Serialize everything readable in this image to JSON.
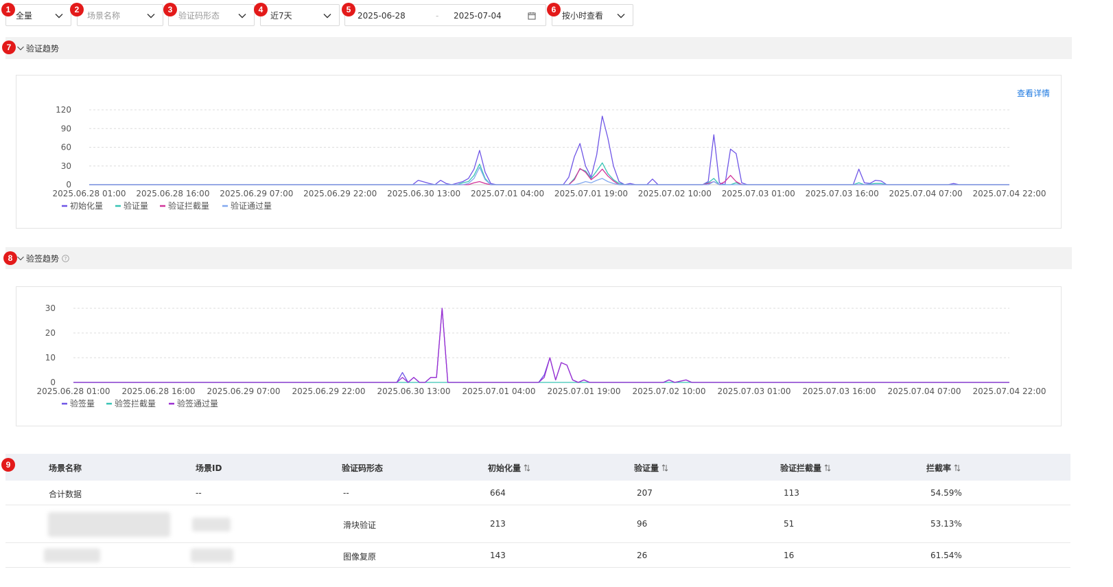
{
  "filters": {
    "scope": "全量",
    "scene_placeholder": "场景名称",
    "captcha_placeholder": "验证码形态",
    "period": "近7天",
    "date_start": "2025-06-28",
    "date_sep": "-",
    "date_end": "2025-07-04",
    "granularity": "按小时查看"
  },
  "badges": [
    "1",
    "2",
    "3",
    "4",
    "5",
    "6",
    "7",
    "8",
    "9"
  ],
  "section_verify": {
    "title": "验证趋势",
    "detail_link": "查看详情"
  },
  "section_sign": {
    "title": "验签趋势"
  },
  "colors": {
    "purple_dark": "#6e55e6",
    "teal": "#37c3b4",
    "magenta": "#d1339a",
    "blue_light": "#82a8ef",
    "violet": "#9b2fd1",
    "badge": "#e31a1a",
    "link": "#1f7ae0"
  },
  "chart_data": [
    {
      "type": "line",
      "title": "",
      "x_ticks": [
        "2025.06.28 01:00",
        "2025.06.28 16:00",
        "2025.06.29 07:00",
        "2025.06.29 22:00",
        "2025.06.30 13:00",
        "2025.07.01 04:00",
        "2025.07.01 19:00",
        "2025.07.02 10:00",
        "2025.07.03 01:00",
        "2025.07.03 16:00",
        "2025.07.04 07:00",
        "2025.07.04 22:00"
      ],
      "ylim": [
        0,
        120
      ],
      "y_ticks": [
        0,
        30,
        60,
        90,
        120
      ],
      "grid": true,
      "legend_position": "bottom-left",
      "hour_range": [
        0,
        165
      ],
      "series": [
        {
          "name": "初始化量",
          "color": "#6e55e6",
          "points": [
            [
              0,
              0
            ],
            [
              58,
              0
            ],
            [
              59,
              7
            ],
            [
              61,
              2
            ],
            [
              62,
              0
            ],
            [
              63,
              7
            ],
            [
              64,
              2
            ],
            [
              65,
              0
            ],
            [
              67,
              5
            ],
            [
              68,
              10
            ],
            [
              69,
              25
            ],
            [
              70,
              55
            ],
            [
              71,
              20
            ],
            [
              72,
              2
            ],
            [
              73,
              0
            ],
            [
              85,
              0
            ],
            [
              86,
              12
            ],
            [
              87,
              45
            ],
            [
              88,
              66
            ],
            [
              89,
              30
            ],
            [
              90,
              12
            ],
            [
              91,
              48
            ],
            [
              92,
              110
            ],
            [
              93,
              75
            ],
            [
              94,
              30
            ],
            [
              95,
              5
            ],
            [
              96,
              0
            ],
            [
              97,
              2
            ],
            [
              98,
              0
            ],
            [
              100,
              0
            ],
            [
              101,
              9
            ],
            [
              102,
              0
            ],
            [
              110,
              0
            ],
            [
              111,
              5
            ],
            [
              112,
              80
            ],
            [
              113,
              3
            ],
            [
              114,
              0
            ],
            [
              115,
              57
            ],
            [
              116,
              50
            ],
            [
              117,
              3
            ],
            [
              118,
              0
            ],
            [
              137,
              0
            ],
            [
              138,
              25
            ],
            [
              139,
              3
            ],
            [
              140,
              2
            ],
            [
              141,
              7
            ],
            [
              142,
              6
            ],
            [
              143,
              0
            ],
            [
              154,
              0
            ],
            [
              155,
              2
            ],
            [
              156,
              0
            ],
            [
              165,
              0
            ]
          ]
        },
        {
          "name": "验证量",
          "color": "#37c3b4",
          "points": [
            [
              0,
              0
            ],
            [
              66,
              0
            ],
            [
              67,
              3
            ],
            [
              68,
              5
            ],
            [
              69,
              15
            ],
            [
              70,
              33
            ],
            [
              71,
              10
            ],
            [
              72,
              0
            ],
            [
              86,
              0
            ],
            [
              87,
              10
            ],
            [
              88,
              25
            ],
            [
              89,
              22
            ],
            [
              90,
              10
            ],
            [
              91,
              22
            ],
            [
              92,
              35
            ],
            [
              93,
              18
            ],
            [
              94,
              8
            ],
            [
              95,
              2
            ],
            [
              96,
              0
            ],
            [
              110,
              0
            ],
            [
              111,
              3
            ],
            [
              112,
              10
            ],
            [
              113,
              0
            ],
            [
              115,
              0
            ],
            [
              116,
              3
            ],
            [
              117,
              0
            ],
            [
              137,
              0
            ],
            [
              138,
              3
            ],
            [
              139,
              0
            ],
            [
              141,
              2
            ],
            [
              142,
              2
            ],
            [
              143,
              0
            ],
            [
              165,
              0
            ]
          ]
        },
        {
          "name": "验证拦截量",
          "color": "#d1339a",
          "points": [
            [
              0,
              0
            ],
            [
              68,
              0
            ],
            [
              69,
              3
            ],
            [
              70,
              5
            ],
            [
              71,
              2
            ],
            [
              72,
              0
            ],
            [
              86,
              0
            ],
            [
              87,
              8
            ],
            [
              88,
              26
            ],
            [
              89,
              20
            ],
            [
              90,
              8
            ],
            [
              91,
              15
            ],
            [
              92,
              25
            ],
            [
              93,
              14
            ],
            [
              94,
              6
            ],
            [
              95,
              0
            ],
            [
              110,
              0
            ],
            [
              111,
              2
            ],
            [
              112,
              5
            ],
            [
              113,
              0
            ],
            [
              114,
              5
            ],
            [
              115,
              15
            ],
            [
              116,
              5
            ],
            [
              117,
              0
            ],
            [
              165,
              0
            ]
          ]
        },
        {
          "name": "验证通过量",
          "color": "#82a8ef",
          "points": [
            [
              0,
              0
            ],
            [
              67,
              0
            ],
            [
              68,
              2
            ],
            [
              69,
              10
            ],
            [
              70,
              28
            ],
            [
              71,
              8
            ],
            [
              72,
              0
            ],
            [
              87,
              0
            ],
            [
              88,
              2
            ],
            [
              89,
              5
            ],
            [
              90,
              3
            ],
            [
              91,
              7
            ],
            [
              92,
              10
            ],
            [
              93,
              5
            ],
            [
              94,
              2
            ],
            [
              95,
              0
            ],
            [
              111,
              0
            ],
            [
              112,
              5
            ],
            [
              113,
              0
            ],
            [
              165,
              0
            ]
          ]
        }
      ]
    },
    {
      "type": "line",
      "title": "",
      "x_ticks": [
        "2025.06.28 01:00",
        "2025.06.28 16:00",
        "2025.06.29 07:00",
        "2025.06.29 22:00",
        "2025.06.30 13:00",
        "2025.07.01 04:00",
        "2025.07.01 19:00",
        "2025.07.02 10:00",
        "2025.07.03 01:00",
        "2025.07.03 16:00",
        "2025.07.04 07:00",
        "2025.07.04 22:00"
      ],
      "ylim": [
        0,
        30
      ],
      "y_ticks": [
        0,
        10,
        20,
        30
      ],
      "grid": true,
      "legend_position": "bottom-left",
      "hour_range": [
        0,
        165
      ],
      "series": [
        {
          "name": "验签量",
          "color": "#6e55e6",
          "points": [
            [
              0,
              0
            ],
            [
              57,
              0
            ],
            [
              58,
              4
            ],
            [
              59,
              0
            ],
            [
              60,
              2
            ],
            [
              61,
              0
            ],
            [
              62,
              0
            ],
            [
              63,
              2
            ],
            [
              64,
              2
            ],
            [
              65,
              30
            ],
            [
              66,
              0
            ],
            [
              82,
              0
            ],
            [
              83,
              3
            ],
            [
              84,
              10
            ],
            [
              85,
              1
            ],
            [
              86,
              8
            ],
            [
              87,
              7
            ],
            [
              88,
              1
            ],
            [
              89,
              0
            ],
            [
              90,
              1
            ],
            [
              91,
              0
            ],
            [
              104,
              0
            ],
            [
              105,
              1
            ],
            [
              106,
              0
            ],
            [
              108,
              1
            ],
            [
              109,
              0
            ],
            [
              165,
              0
            ]
          ]
        },
        {
          "name": "验签拦截量",
          "color": "#37c3b4",
          "points": [
            [
              0,
              0
            ],
            [
              165,
              0
            ]
          ]
        },
        {
          "name": "验签通过量",
          "color": "#9b2fd1",
          "points": [
            [
              0,
              0
            ],
            [
              57,
              0
            ],
            [
              58,
              2
            ],
            [
              59,
              0
            ],
            [
              60,
              2
            ],
            [
              61,
              0
            ],
            [
              62,
              0
            ],
            [
              63,
              2
            ],
            [
              64,
              2
            ],
            [
              65,
              30
            ],
            [
              66,
              0
            ],
            [
              82,
              0
            ],
            [
              83,
              2
            ],
            [
              84,
              10
            ],
            [
              85,
              1
            ],
            [
              86,
              8
            ],
            [
              87,
              7
            ],
            [
              88,
              1
            ],
            [
              89,
              0
            ],
            [
              90,
              1
            ],
            [
              91,
              0
            ],
            [
              104,
              0
            ],
            [
              105,
              1
            ],
            [
              106,
              0
            ],
            [
              108,
              1
            ],
            [
              109,
              0
            ],
            [
              165,
              0
            ]
          ]
        }
      ]
    }
  ],
  "table": {
    "headers": [
      "场景名称",
      "场景ID",
      "验证码形态",
      "初始化量",
      "验证量",
      "验证拦截量",
      "拦截率"
    ],
    "rows": [
      [
        "合计数据",
        "--",
        "--",
        "664",
        "207",
        "113",
        "54.59%"
      ],
      [
        "",
        "",
        "滑块验证",
        "213",
        "96",
        "51",
        "53.13%"
      ],
      [
        "",
        "",
        "图像复原",
        "143",
        "26",
        "16",
        "61.54%"
      ]
    ]
  }
}
